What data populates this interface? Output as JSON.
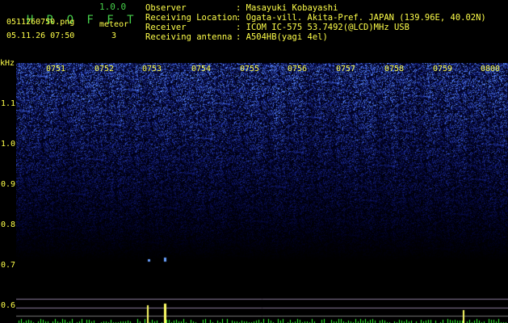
{
  "header": {
    "app_title": "H R O F F T",
    "app_version": "1.0.0",
    "filename": "0511260750.png",
    "datetime": "05.11.26 07:50",
    "meteor_label": "meteor",
    "meteor_count": "3"
  },
  "info": [
    {
      "label": "Observer",
      "value": ": Masayuki Kobayashi"
    },
    {
      "label": "Receiving Location",
      "value": ": Ogata-vill. Akita-Pref. JAPAN (139.96E, 40.02N)"
    },
    {
      "label": "Receiver",
      "value": ": ICOM IC-575 53.7492(@LCD)MHz USB"
    },
    {
      "label": "Receiving antenna",
      "value": ": A504HB(yagi 4el)"
    }
  ],
  "spectrogram": {
    "freq_unit": "kHz",
    "freq_labels": [
      "1.1",
      "1.0",
      "0.9",
      "0.8",
      "0.7",
      "0.6"
    ],
    "time_labels": [
      "0751",
      "0752",
      "0753",
      "0754",
      "0755",
      "0756",
      "0757",
      "0758",
      "0759",
      "0800"
    ],
    "colors": {
      "text": "#ffff4a",
      "title": "#46d04a",
      "noise": "#2a4cff",
      "peak": "#ffff66"
    }
  }
}
